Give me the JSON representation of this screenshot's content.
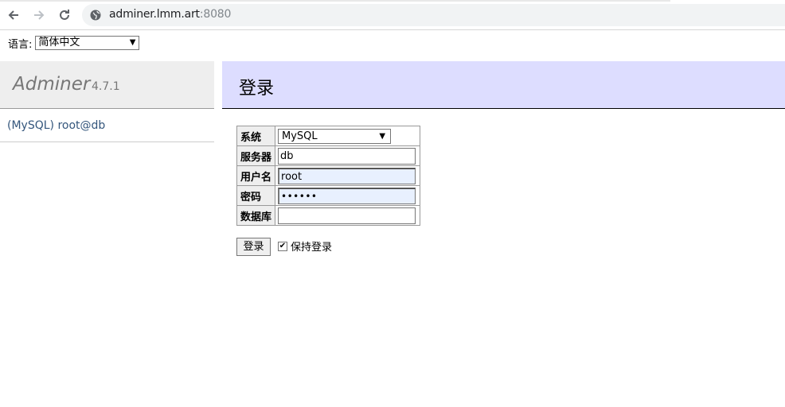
{
  "browser": {
    "url_host": "adminer.lmm.art",
    "url_port": ":8080"
  },
  "language": {
    "label": "语言:",
    "selected": "简体中文"
  },
  "menu": {
    "brand": "Adminer",
    "version": "4.7.1",
    "db_link": "(MySQL) root@db"
  },
  "content": {
    "title": "登录"
  },
  "login_form": {
    "system_label": "系统",
    "system_value": "MySQL",
    "server_label": "服务器",
    "server_value": "db",
    "username_label": "用户名",
    "username_value": "root",
    "password_label": "密码",
    "password_value": "••••••",
    "database_label": "数据库",
    "database_value": "",
    "submit_label": "登录",
    "remember_label": "保持登录",
    "remember_checked": true
  }
}
